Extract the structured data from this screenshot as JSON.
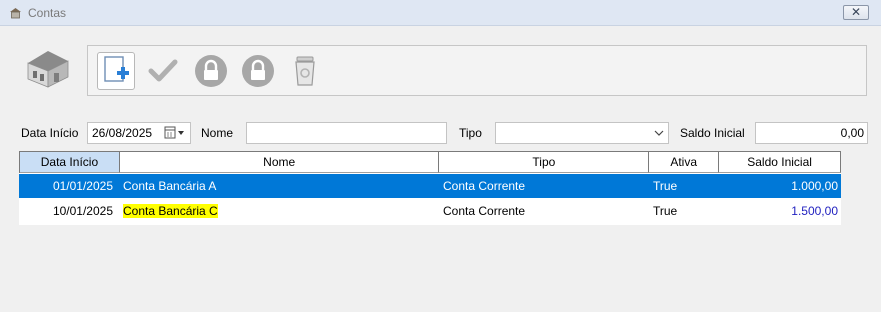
{
  "window": {
    "title": "Contas",
    "close_label": "✕"
  },
  "toolbar": {
    "buttons": [
      {
        "name": "new-button",
        "icon": "new-document-icon",
        "active": true
      },
      {
        "name": "confirm-button",
        "icon": "checkmark-icon",
        "active": false
      },
      {
        "name": "unlock-button",
        "icon": "lock-icon",
        "active": false
      },
      {
        "name": "lock-button",
        "icon": "lock-icon",
        "active": false
      },
      {
        "name": "delete-button",
        "icon": "trash-icon",
        "active": false
      }
    ]
  },
  "filters": {
    "date_label": "Data Início",
    "date_value": "26/08/2025",
    "nome_label": "Nome",
    "nome_value": "",
    "tipo_label": "Tipo",
    "tipo_value": "",
    "saldo_label": "Saldo Inicial",
    "saldo_value": "0,00"
  },
  "grid": {
    "columns": [
      "Data Início",
      "Nome",
      "Tipo",
      "Ativa",
      "Saldo Inicial"
    ],
    "rows": [
      {
        "data": "01/01/2025",
        "nome": "Conta Bancária A",
        "tipo": "Conta Corrente",
        "ativa": "True",
        "saldo": "1.000,00",
        "selected": true
      },
      {
        "data": "10/01/2025",
        "nome": "Conta Bancária C",
        "tipo": "Conta Corrente",
        "ativa": "True",
        "saldo": "1.500,00",
        "selected": false
      }
    ]
  },
  "colors": {
    "selection": "#0078d7",
    "header_highlight": "#c9def5",
    "text_highlight": "#ffff00",
    "saldo_text": "#1f1fbf"
  }
}
